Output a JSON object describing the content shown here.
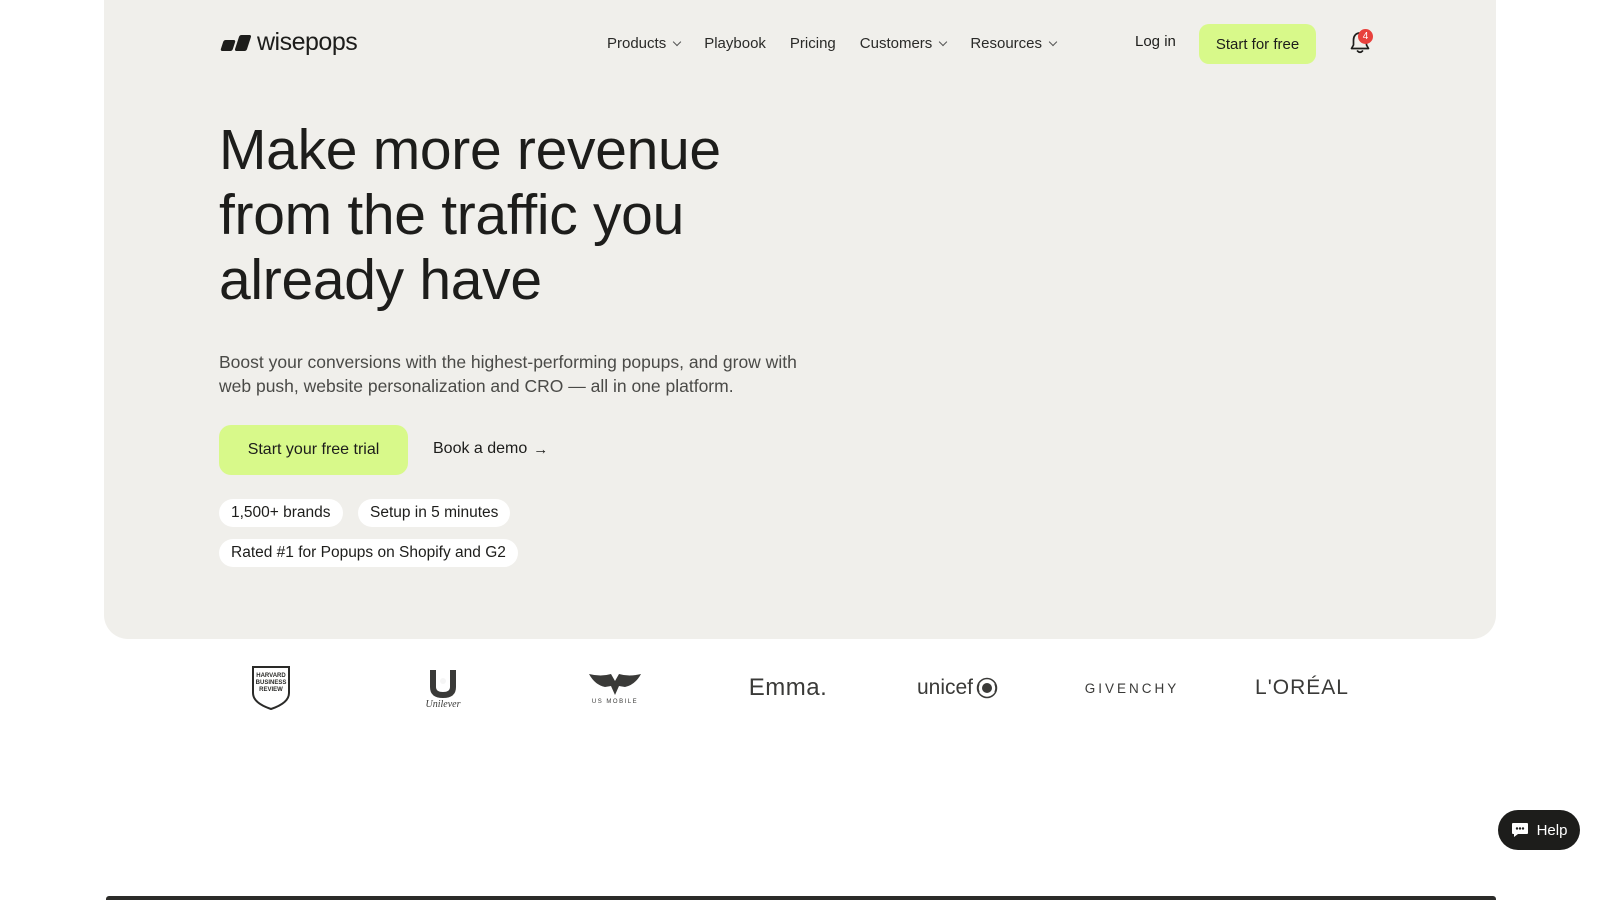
{
  "brand": {
    "name": "wisepops"
  },
  "nav": {
    "items": [
      {
        "label": "Products",
        "dropdown": true
      },
      {
        "label": "Playbook",
        "dropdown": false
      },
      {
        "label": "Pricing",
        "dropdown": false
      },
      {
        "label": "Customers",
        "dropdown": true
      },
      {
        "label": "Resources",
        "dropdown": true
      }
    ],
    "login": "Log in",
    "start_free": "Start for free",
    "notifications_count": "4"
  },
  "hero": {
    "headline": "Make more revenue from the traffic you already have",
    "subline": "Boost your conversions with the highest-performing popups, and grow with web push, website personalization and CRO — all in one platform.",
    "cta_primary": "Start your free trial",
    "cta_secondary": "Book a demo",
    "pills": [
      "1,500+ brands",
      "Setup in 5 minutes",
      "Rated #1 for Popups on Shopify and G2"
    ]
  },
  "logos": {
    "hbr": [
      "HARVARD",
      "BUSINESS",
      "REVIEW"
    ],
    "unilever": "Unilever",
    "usmobile": "US MOBILE",
    "emma": "Emma.",
    "unicef": "unicef",
    "givenchy": "GIVENCHY",
    "loreal": "L'ORÉAL"
  },
  "help": {
    "label": "Help"
  },
  "colors": {
    "hero_bg": "#f0efeb",
    "accent": "#d8f98a",
    "text": "#1d1d1b",
    "badge": "#e8413c"
  }
}
